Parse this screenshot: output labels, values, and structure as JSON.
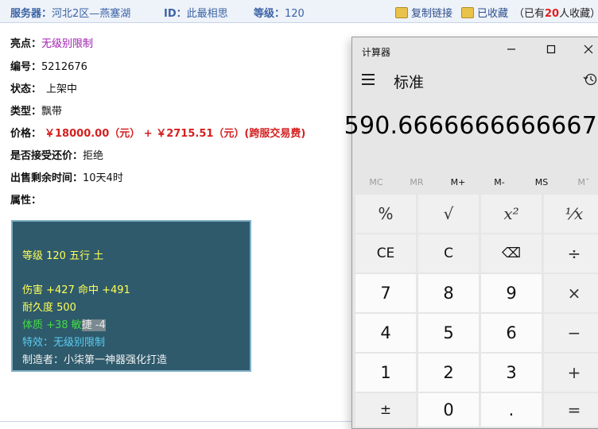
{
  "header": {
    "server_label": "服务器：",
    "server_value": "河北2区—燕塞湖",
    "id_label": "ID：",
    "id_value": "此最相思",
    "level_label": "等级：",
    "level_value": "120",
    "copy_link": "复制链接",
    "favorited": "已收藏",
    "fav_count_prefix": "（已有",
    "fav_count": "20",
    "fav_count_suffix": "人收藏）"
  },
  "item": {
    "highlight_label": "亮点：",
    "highlight_value": "无级别限制",
    "number_label": "编号：",
    "number_value": "5212676",
    "status_label": "状态：",
    "status_value": "上架中",
    "type_label": "类型：",
    "type_value": "飘带",
    "price_label": "价格：",
    "price_value": "￥18000.00（元） + ￥2715.51（元）(跨服交易费)",
    "counter_offer_label": "是否接受还价：",
    "counter_offer_value": "拒绝",
    "time_left_label": "出售剩余时间：",
    "time_left_value": "10天4时",
    "attr_label": "属性："
  },
  "attributes": {
    "level_line": "等级 120 五行 土",
    "damage_line": "伤害 +427 命中 +491",
    "durability_line": "耐久度 500",
    "stat_line_a": "体质 +38 敏",
    "stat_line_b": "捷 -4",
    "effect_line": "特效：无级别限制",
    "maker_line": "制造者：小柒第一神器强化打造"
  },
  "calculator": {
    "window_title": "计算器",
    "mode": "标准",
    "display": "590.6666666666667",
    "memory": [
      "MC",
      "MR",
      "M+",
      "M-",
      "MS",
      "Mˇ"
    ],
    "keys": {
      "percent": "%",
      "sqrt": "√",
      "square": "x²",
      "reciprocal": "¹⁄x",
      "ce": "CE",
      "c": "C",
      "backspace": "⌫",
      "divide": "÷",
      "n7": "7",
      "n8": "8",
      "n9": "9",
      "multiply": "×",
      "n4": "4",
      "n5": "5",
      "n6": "6",
      "minus": "−",
      "n1": "1",
      "n2": "2",
      "n3": "3",
      "plus": "+",
      "negate": "±",
      "n0": "0",
      "decimal": ".",
      "equals": "="
    }
  },
  "colors": {
    "accent_blue": "#3a63a5",
    "price_red": "#d42020",
    "highlight_purple": "#a020b0",
    "attr_bg": "#2e5a6c"
  }
}
